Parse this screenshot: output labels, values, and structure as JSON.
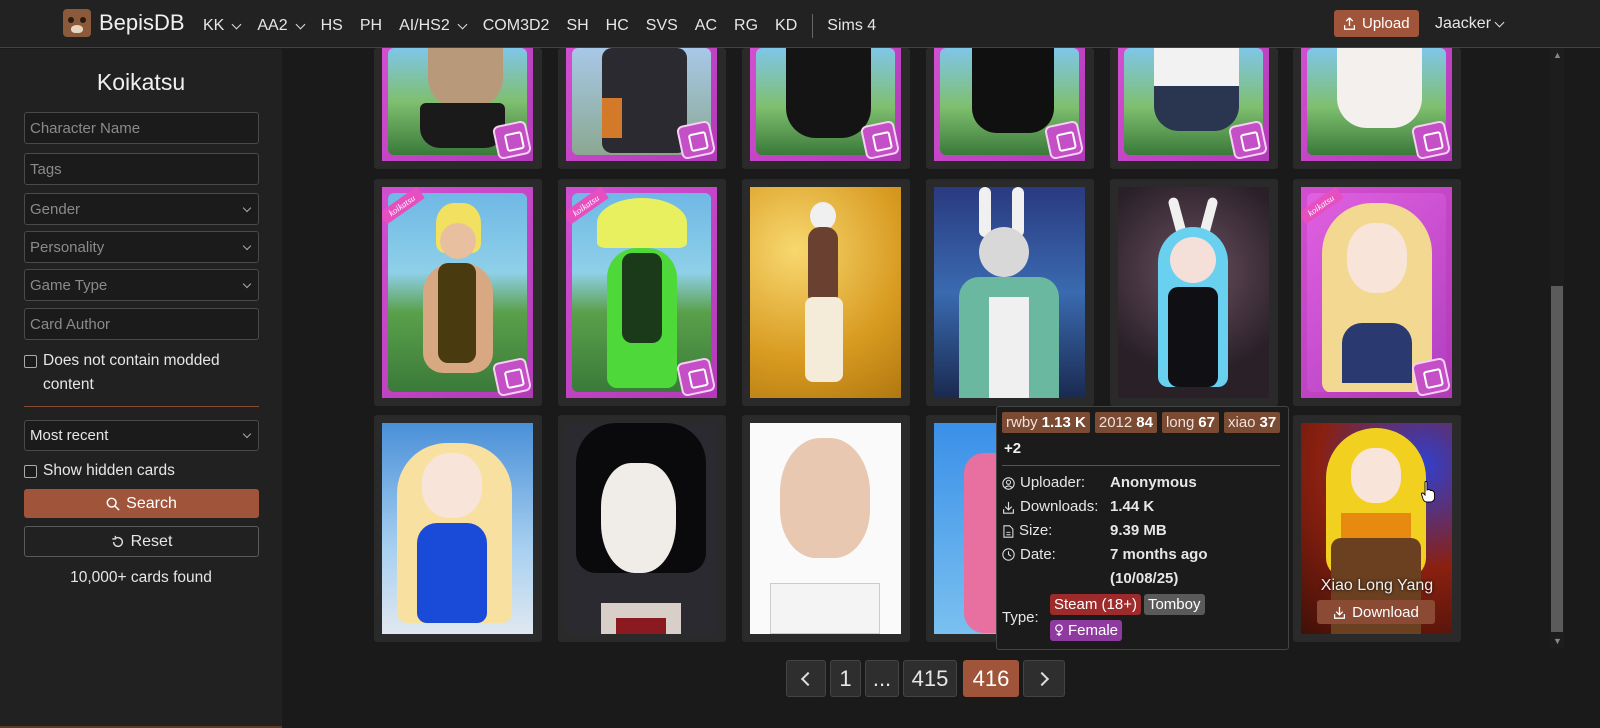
{
  "navbar": {
    "brand": "BepisDB",
    "items": [
      {
        "label": "KK",
        "dropdown": true
      },
      {
        "label": "AA2",
        "dropdown": true
      },
      {
        "label": "HS",
        "dropdown": false
      },
      {
        "label": "PH",
        "dropdown": false
      },
      {
        "label": "AI/HS2",
        "dropdown": true
      },
      {
        "label": "COM3D2",
        "dropdown": false
      },
      {
        "label": "SH",
        "dropdown": false
      },
      {
        "label": "HC",
        "dropdown": false
      },
      {
        "label": "SVS",
        "dropdown": false
      },
      {
        "label": "AC",
        "dropdown": false
      },
      {
        "label": "RG",
        "dropdown": false
      },
      {
        "label": "KD",
        "dropdown": false
      }
    ],
    "extra_item": "Sims 4",
    "upload_label": "Upload",
    "user": "Jaacker"
  },
  "sidebar": {
    "title": "Koikatsu",
    "character_name_placeholder": "Character Name",
    "tags_placeholder": "Tags",
    "gender_label": "Gender",
    "personality_label": "Personality",
    "game_type_label": "Game Type",
    "card_author_placeholder": "Card Author",
    "modded_label": "Does not contain modded content",
    "sort_label": "Most recent",
    "hidden_label": "Show hidden cards",
    "search_label": "Search",
    "reset_label": "Reset",
    "count_text": "10,000+ cards found"
  },
  "tooltip": {
    "tags": [
      {
        "name": "rwby",
        "count": "1.13 K"
      },
      {
        "name": "2012",
        "count": "84"
      },
      {
        "name": "long",
        "count": "67"
      },
      {
        "name": "xiao",
        "count": "37"
      }
    ],
    "more": "+2",
    "uploader_label": "Uploader:",
    "uploader": "Anonymous",
    "downloads_label": "Downloads:",
    "downloads": "1.44 K",
    "size_label": "Size:",
    "size": "9.39 MB",
    "date_label": "Date:",
    "date": "7 months ago (10/08/25)",
    "type_label": "Type:",
    "badges": [
      {
        "label": "Steam (18+)",
        "color": "#9e2b2b"
      },
      {
        "label": "Tomboy",
        "color": "#5a5a5a"
      },
      {
        "label": "Female",
        "color": "#8e3a9e"
      }
    ]
  },
  "hovered_card": {
    "title": "Xiao Long Yang",
    "download_label": "Download"
  },
  "pagination": {
    "first": "1",
    "ellipsis": "...",
    "prev_page": "415",
    "current": "416"
  },
  "colors": {
    "accent": "#a0553a",
    "koikatsu_frame": "#d24fd0"
  }
}
